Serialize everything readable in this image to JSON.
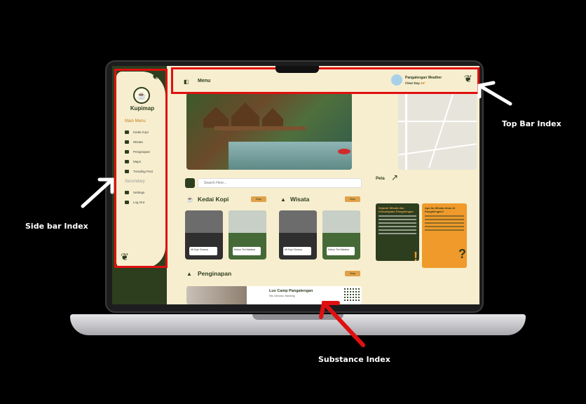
{
  "app": {
    "logo_text": "Kupimap",
    "logo_icon": "coffee-cup-icon"
  },
  "sidebar": {
    "main_menu_label": "Main Menu",
    "secondary_label": "Secondary",
    "main_items": [
      {
        "label": "Kedai Kopi",
        "icon": "coffee-icon"
      },
      {
        "label": "Wisata",
        "icon": "mountain-icon"
      },
      {
        "label": "Penginapan",
        "icon": "bed-icon"
      },
      {
        "label": "Maps",
        "icon": "map-icon"
      },
      {
        "label": "Trending Post",
        "icon": "fire-icon"
      }
    ],
    "secondary_items": [
      {
        "label": "Settings",
        "icon": "settings-icon"
      },
      {
        "label": "Log Out",
        "icon": "logout-icon"
      }
    ]
  },
  "topbar": {
    "menu_label": "Menu",
    "weather_location": "Pangalengan Weather",
    "weather_condition": "Clear Day",
    "weather_temp": "24°"
  },
  "content": {
    "search_placeholder": "Search Here...",
    "map_label": "Peta",
    "sections": {
      "kedai_kopi": {
        "title": "Kedai Kopi",
        "pill": "Map"
      },
      "wisata": {
        "title": "Wisata",
        "pill": "Map"
      },
      "penginapan": {
        "title": "Penginapan",
        "pill": "Map"
      }
    },
    "cards": [
      {
        "label": "Mt Kopi Cisarua"
      },
      {
        "label": "Kebun Teh Malabar"
      },
      {
        "label": "Mt Kopi Cisarua"
      },
      {
        "label": "Kebun Teh Malabar"
      }
    ],
    "info_green_title": "Sejarah Wisata dan Kebudayaan Pangalengan",
    "info_orange_title": "Apa Itu Wisata Alam di Pangalengan?",
    "penginapan_card": {
      "name": "Lux Camp Pangalengan",
      "location": "Situ Cileunca, Bandung"
    }
  },
  "annotations": {
    "top_bar": "Top Bar Index",
    "side_bar": "Side bar Index",
    "substance": "Substance Index"
  },
  "colors": {
    "annotation_red": "#e01010",
    "brand_dark_green": "#2d3e1f",
    "brand_orange": "#ef9a2b",
    "background_cream": "#f7eecf"
  }
}
